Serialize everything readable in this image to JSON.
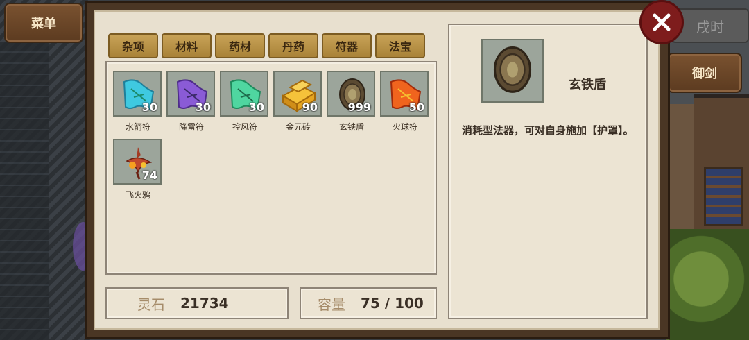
{
  "hud": {
    "menu_label": "菜单",
    "time_label": "戌时",
    "sword_label": "御剑"
  },
  "tabs": [
    "杂项",
    "材料",
    "药材",
    "丹药",
    "符器",
    "法宝"
  ],
  "items": [
    {
      "name": "水箭符",
      "qty": "30",
      "icon": "talisman-scroll-cyan-icon",
      "color": "#3fc9e0"
    },
    {
      "name": "降雷符",
      "qty": "30",
      "icon": "talisman-scroll-purple-icon",
      "color": "#8a5bd6"
    },
    {
      "name": "控风符",
      "qty": "30",
      "icon": "talisman-scroll-green-icon",
      "color": "#4fd6a0"
    },
    {
      "name": "金元砖",
      "qty": "90",
      "icon": "gold-brick-icon",
      "color": "#e9a520"
    },
    {
      "name": "玄铁盾",
      "qty": "999",
      "icon": "iron-shield-icon",
      "color": "#5b4a32"
    },
    {
      "name": "火球符",
      "qty": "50",
      "icon": "talisman-scroll-fire-icon",
      "color": "#f0641e"
    },
    {
      "name": "飞火鸦",
      "qty": "74",
      "icon": "fire-crow-icon",
      "color": "#c0492c"
    }
  ],
  "stats": {
    "stone_label": "灵石",
    "stone_value": "21734",
    "capacity_label": "容量",
    "capacity_value": "75 / 100"
  },
  "detail": {
    "name": "玄铁盾",
    "icon": "iron-shield-icon",
    "description": "消耗型法器，可对自身施加【护罩】。"
  }
}
